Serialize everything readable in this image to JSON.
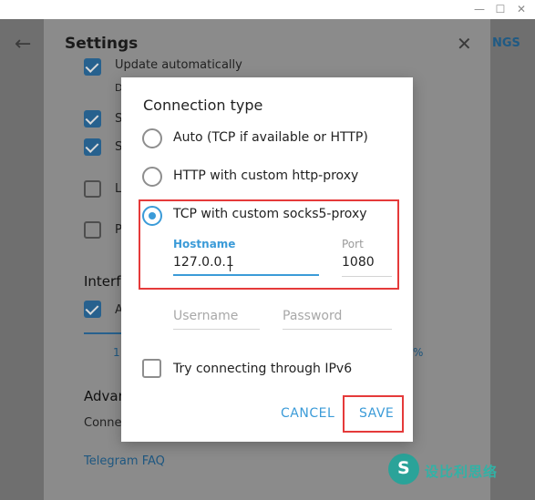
{
  "window": {
    "minimize_glyph": "—",
    "maximize_glyph": "☐",
    "close_glyph": "✕"
  },
  "background": {
    "settings_title": "Settings",
    "right_text": "NGS",
    "checkbox_labels": [
      "Update automatically",
      "S",
      "S",
      "L",
      "P",
      "A"
    ],
    "subtext_d": "D",
    "interface_heading": "Interf",
    "scale_left": "1",
    "scale_right": "%",
    "advanced_heading": "Advan",
    "connection_text": "Conne",
    "faq_link": "Telegram FAQ"
  },
  "watermark": {
    "text": "设比利思络"
  },
  "dialog": {
    "title": "Connection type",
    "options": [
      {
        "label": "Auto (TCP if available or HTTP)",
        "selected": false
      },
      {
        "label": "HTTP with custom http-proxy",
        "selected": false
      },
      {
        "label": "TCP with custom socks5-proxy",
        "selected": true
      }
    ],
    "hostname": {
      "label": "Hostname",
      "value": "127.0.0.1"
    },
    "port": {
      "label": "Port",
      "value": "1080"
    },
    "username": {
      "placeholder": "Username"
    },
    "password": {
      "placeholder": "Password"
    },
    "ipv6": {
      "label": "Try connecting through IPv6",
      "checked": false
    },
    "cancel_label": "CANCEL",
    "save_label": "SAVE"
  },
  "colors": {
    "accent": "#3b9bd8",
    "highlight": "#e53a3a"
  }
}
